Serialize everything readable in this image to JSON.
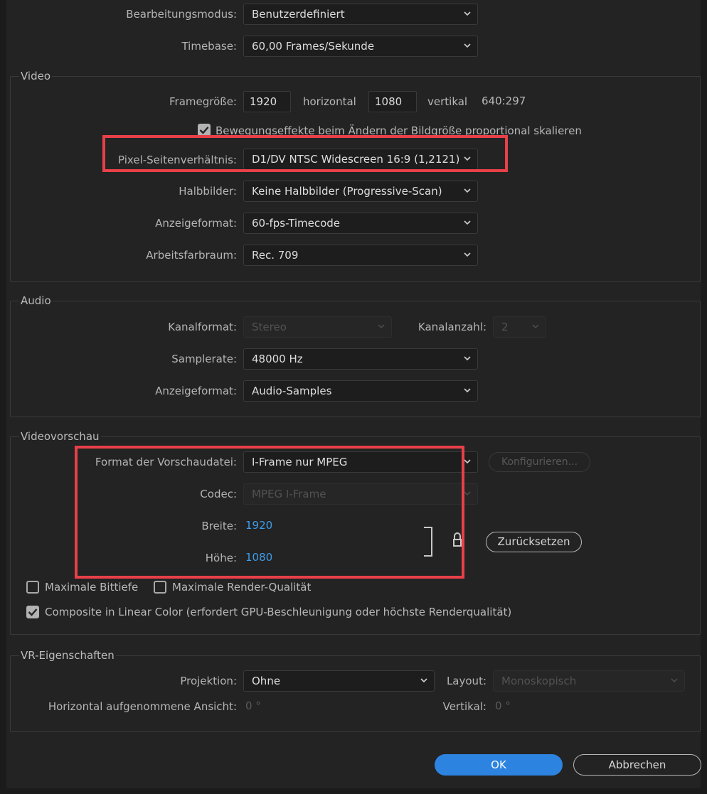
{
  "general": {
    "editing_mode_label": "Bearbeitungsmodus:",
    "editing_mode_value": "Benutzerdefiniert",
    "timebase_label": "Timebase:",
    "timebase_value": "60,00  Frames/Sekunde"
  },
  "video": {
    "title": "Video",
    "frame_size_label": "Framegröße:",
    "frame_width": "1920",
    "horizontal_label": "horizontal",
    "frame_height": "1080",
    "vertical_label": "vertikal",
    "aspect_ratio": "640:297",
    "scale_checkbox_label": "Bewegungseffekte beim Ändern der Bildgröße proportional skalieren",
    "pixel_aspect_label": "Pixel-Seitenverhältnis:",
    "pixel_aspect_value": "D1/DV NTSC Widescreen 16:9 (1,2121)",
    "fields_label": "Halbbilder:",
    "fields_value": "Keine Halbbilder (Progressive-Scan)",
    "display_format_label": "Anzeigeformat:",
    "display_format_value": "60-fps-Timecode",
    "color_space_label": "Arbeitsfarbraum:",
    "color_space_value": "Rec. 709"
  },
  "audio": {
    "title": "Audio",
    "channel_format_label": "Kanalformat:",
    "channel_format_value": "Stereo",
    "channel_count_label": "Kanalanzahl:",
    "channel_count_value": "2",
    "sample_rate_label": "Samplerate:",
    "sample_rate_value": "48000 Hz",
    "display_format_label": "Anzeigeformat:",
    "display_format_value": "Audio-Samples"
  },
  "preview": {
    "title": "Videovorschau",
    "file_format_label": "Format der Vorschaudatei:",
    "file_format_value": "I-Frame nur MPEG",
    "configure_label": "Konfigurieren...",
    "codec_label": "Codec:",
    "codec_value": "MPEG I-Frame",
    "width_label": "Breite:",
    "width_value": "1920",
    "height_label": "Höhe:",
    "height_value": "1080",
    "reset_label": "Zurücksetzen",
    "max_bit_depth_label": "Maximale Bittiefe",
    "max_render_quality_label": "Maximale Render-Qualität",
    "composite_label": "Composite in Linear Color (erfordert GPU-Beschleunigung oder höchste Renderqualität)"
  },
  "vr": {
    "title": "VR-Eigenschaften",
    "projection_label": "Projektion:",
    "projection_value": "Ohne",
    "layout_label": "Layout:",
    "layout_value": "Monoskopisch",
    "horizontal_view_label": "Horizontal aufgenommene Ansicht:",
    "horizontal_view_value": "0 °",
    "vertical_label": "Vertikal:",
    "vertical_value": "0 °"
  },
  "footer": {
    "ok_label": "OK",
    "cancel_label": "Abbrechen"
  },
  "checkboxes": {
    "scale_checked": true,
    "max_bit_depth_checked": false,
    "max_render_quality_checked": false,
    "composite_checked": true
  },
  "colors": {
    "background": "#232323",
    "accent": "#2c84e0",
    "link_value": "#3e9ce9",
    "highlight": "#e84048"
  }
}
